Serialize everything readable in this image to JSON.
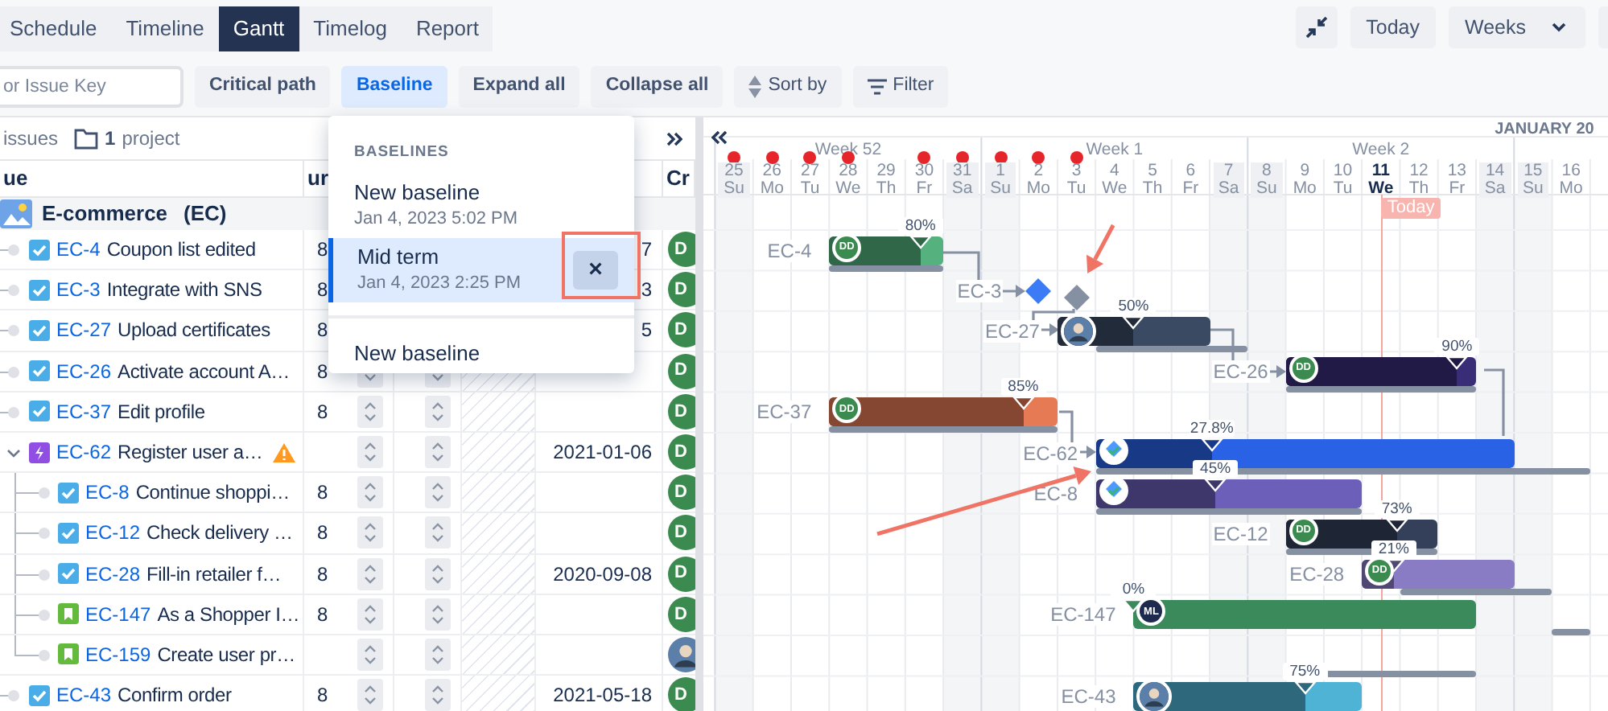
{
  "view_tabs": [
    {
      "label": "Schedule",
      "selected": false
    },
    {
      "label": "Timeline",
      "selected": false
    },
    {
      "label": "Gantt",
      "selected": true
    },
    {
      "label": "Timelog",
      "selected": false
    },
    {
      "label": "Report",
      "selected": false
    }
  ],
  "view_controls": {
    "today": "Today",
    "scale": "Weeks"
  },
  "search": {
    "placeholder": "or Issue Key"
  },
  "toolbar": [
    {
      "kind": "plain",
      "label": "Critical path",
      "selected": false
    },
    {
      "kind": "plain",
      "label": "Baseline",
      "selected": true
    },
    {
      "kind": "plain",
      "label": "Expand all",
      "selected": false
    },
    {
      "kind": "plain",
      "label": "Collapse all",
      "selected": false
    },
    {
      "kind": "sort",
      "label": "Sort by",
      "selected": false
    },
    {
      "kind": "filter",
      "label": "Filter",
      "selected": false
    }
  ],
  "summary": {
    "issues": "issues",
    "project_count": "1",
    "project": "project"
  },
  "columns": [
    "ue",
    "ur",
    "Cr"
  ],
  "group": {
    "name": "E-commerce",
    "key": "(EC)"
  },
  "issues": [
    {
      "kind": "task",
      "key": "EC-4",
      "title": "Coupon list edited",
      "estimate": "8",
      "spinners": false,
      "date": "7",
      "warning": false,
      "assignee": {
        "kind": "initials",
        "text": "D"
      },
      "bar": {
        "kind": "bar",
        "label": "EC-4",
        "level": 0.8,
        "progress": "80%",
        "color": "#55b27e",
        "avatar": {
          "kind": "initials",
          "text": "DD",
          "color": "#3b8a4f"
        }
      },
      "baseline": true
    },
    {
      "kind": "task",
      "key": "EC-3",
      "title": "Integrate with SNS",
      "estimate": "8",
      "spinners": false,
      "date": "3",
      "warning": false,
      "assignee": {
        "kind": "initials",
        "text": "D"
      },
      "bar": {
        "kind": "milestone",
        "label": "EC-3",
        "color": "#3b7cf6"
      },
      "baseline": true
    },
    {
      "kind": "task",
      "key": "EC-27",
      "title": "Upload certificates",
      "estimate": "8",
      "spinners": false,
      "date": "5",
      "warning": false,
      "assignee": {
        "kind": "initials",
        "text": "D"
      },
      "bar": {
        "kind": "bar",
        "label": "EC-27",
        "level": 0.5,
        "progress": "50%",
        "color": "#3a4a62",
        "avatar": {
          "kind": "photo"
        }
      },
      "baseline": true
    },
    {
      "kind": "task",
      "key": "EC-26",
      "title": "Activate account A…",
      "estimate": "8",
      "spinners": true,
      "warning": false,
      "assignee": {
        "kind": "initials",
        "text": "D"
      },
      "bar": {
        "kind": "bar",
        "label": "EC-26",
        "level": 0.9,
        "progress": "90%",
        "color": "#3a2d78",
        "avatar": {
          "kind": "initials",
          "text": "DD",
          "color": "#3b8a4f"
        }
      },
      "baseline": true
    },
    {
      "kind": "task",
      "key": "EC-37",
      "title": "Edit profile",
      "estimate": "8",
      "spinners": true,
      "warning": false,
      "assignee": {
        "kind": "initials",
        "text": "D"
      },
      "bar": {
        "kind": "bar",
        "label": "EC-37",
        "level": 0.85,
        "progress": "85%",
        "color": "#e57a55",
        "avatar": {
          "kind": "initials",
          "text": "DD",
          "color": "#3b8a4f"
        }
      },
      "baseline": true
    },
    {
      "kind": "epic",
      "key": "EC-62",
      "title": "Register user a…",
      "spinners": true,
      "date": "2021-01-06",
      "warning": true,
      "expanded": true,
      "assignee": {
        "kind": "initials",
        "text": "D"
      },
      "bar": {
        "kind": "bar",
        "label": "EC-62",
        "level": 0.278,
        "progress": "27.8%",
        "color": "#2a62e6",
        "avatar": {
          "kind": "icon"
        }
      },
      "baseline": true,
      "children": [
        {
          "kind": "task",
          "key": "EC-8",
          "title": "Continue shoppi…",
          "estimate": "8",
          "spinners": true,
          "warning": false,
          "assignee": {
            "kind": "initials",
            "text": "D"
          },
          "bar": {
            "kind": "bar",
            "label": "EC-8",
            "level": 0.45,
            "progress": "45%",
            "color": "#6b5fba",
            "avatar": {
              "kind": "icon"
            }
          },
          "baseline": true
        },
        {
          "kind": "task",
          "key": "EC-12",
          "title": "Check delivery …",
          "estimate": "8",
          "spinners": true,
          "warning": false,
          "assignee": {
            "kind": "initials",
            "text": "D"
          },
          "bar": {
            "kind": "bar",
            "label": "EC-12",
            "level": 0.73,
            "progress": "73%",
            "color": "#344059",
            "avatar": {
              "kind": "initials",
              "text": "DD",
              "color": "#3b8a4f"
            }
          },
          "baseline": true
        },
        {
          "kind": "task",
          "key": "EC-28",
          "title": "Fill-in retailer f…",
          "estimate": "8",
          "spinners": true,
          "date": "2020-09-08",
          "warning": false,
          "assignee": {
            "kind": "initials",
            "text": "D"
          },
          "bar": {
            "kind": "bar",
            "label": "EC-28",
            "level": 0.21,
            "progress": "21%",
            "color": "#8a7cc4",
            "avatar": {
              "kind": "initials",
              "text": "DD",
              "color": "#3b8a4f"
            }
          },
          "baseline": true
        },
        {
          "kind": "story",
          "key": "EC-147",
          "title": "As a Shopper I…",
          "estimate": "8",
          "spinners": true,
          "warning": false,
          "assignee": {
            "kind": "initials",
            "text": "D"
          },
          "bar": {
            "kind": "bar",
            "label": "EC-147",
            "level": 0,
            "progress": "0%",
            "color": "#3a8a5b",
            "avatar": {
              "kind": "initials",
              "text": "ML",
              "color": "#1d2a4d"
            }
          },
          "baseline": true
        },
        {
          "kind": "story",
          "key": "EC-159",
          "title": "Create user pr…",
          "spinners": true,
          "warning": false,
          "assignee": {
            "kind": "photo"
          },
          "baseline": true
        }
      ]
    },
    {
      "kind": "task",
      "key": "EC-43",
      "title": "Confirm order",
      "estimate": "8",
      "spinners": true,
      "date": "2021-05-18",
      "warning": false,
      "assignee": {
        "kind": "initials",
        "text": "D"
      },
      "bar": {
        "kind": "bar",
        "label": "EC-43",
        "level": 0.75,
        "progress": "75%",
        "color": "#4fb3d6",
        "avatar": {
          "kind": "photo"
        }
      },
      "baseline": false
    }
  ],
  "baseline_menu": {
    "heading": "BASELINES",
    "items": [
      {
        "name": "New baseline",
        "date": "Jan 4, 2023 5:02 PM",
        "selected": false
      },
      {
        "name": "Mid term",
        "date": "Jan 4, 2023 2:25 PM",
        "selected": true
      }
    ],
    "remove": "×",
    "footer": "New baseline"
  },
  "timeline": {
    "month": "JANUARY 20",
    "today_label": "Today",
    "weeks": [
      {
        "label": "Week 52"
      },
      {
        "label": "Week 1"
      },
      {
        "label": "Week 2"
      }
    ],
    "days": [
      {
        "day": "25",
        "dow": "Su",
        "weekend": true,
        "today": false,
        "alert": true
      },
      {
        "day": "26",
        "dow": "Mo",
        "weekend": false,
        "today": false,
        "alert": true
      },
      {
        "day": "27",
        "dow": "Tu",
        "weekend": false,
        "today": false,
        "alert": true
      },
      {
        "day": "28",
        "dow": "We",
        "weekend": false,
        "today": false,
        "alert": true
      },
      {
        "day": "29",
        "dow": "Th",
        "weekend": false,
        "today": false,
        "alert": false
      },
      {
        "day": "30",
        "dow": "Fr",
        "weekend": false,
        "today": false,
        "alert": true
      },
      {
        "day": "31",
        "dow": "Sa",
        "weekend": true,
        "today": false,
        "alert": true
      },
      {
        "day": "1",
        "dow": "Su",
        "weekend": true,
        "today": false,
        "alert": true
      },
      {
        "day": "2",
        "dow": "Mo",
        "weekend": false,
        "today": false,
        "alert": true
      },
      {
        "day": "3",
        "dow": "Tu",
        "weekend": false,
        "today": false,
        "alert": true
      },
      {
        "day": "4",
        "dow": "We",
        "weekend": false,
        "today": false,
        "alert": false
      },
      {
        "day": "5",
        "dow": "Th",
        "weekend": false,
        "today": false,
        "alert": false
      },
      {
        "day": "6",
        "dow": "Fr",
        "weekend": false,
        "today": false,
        "alert": false
      },
      {
        "day": "7",
        "dow": "Sa",
        "weekend": true,
        "today": false,
        "alert": false
      },
      {
        "day": "8",
        "dow": "Su",
        "weekend": true,
        "today": false,
        "alert": false
      },
      {
        "day": "9",
        "dow": "Mo",
        "weekend": false,
        "today": false,
        "alert": false
      },
      {
        "day": "10",
        "dow": "Tu",
        "weekend": false,
        "today": false,
        "alert": false
      },
      {
        "day": "11",
        "dow": "We",
        "weekend": false,
        "today": true,
        "alert": false
      },
      {
        "day": "12",
        "dow": "Th",
        "weekend": false,
        "today": false,
        "alert": false
      },
      {
        "day": "13",
        "dow": "Fr",
        "weekend": false,
        "today": false,
        "alert": false
      },
      {
        "day": "14",
        "dow": "Sa",
        "weekend": true,
        "today": false,
        "alert": false
      },
      {
        "day": "15",
        "dow": "Su",
        "weekend": true,
        "today": false,
        "alert": false
      },
      {
        "day": "16",
        "dow": "Mo",
        "weekend": false,
        "today": false,
        "alert": false
      }
    ]
  },
  "annotations": [
    {
      "kind": "arrow"
    },
    {
      "kind": "arrow"
    },
    {
      "kind": "highlight-box"
    }
  ]
}
